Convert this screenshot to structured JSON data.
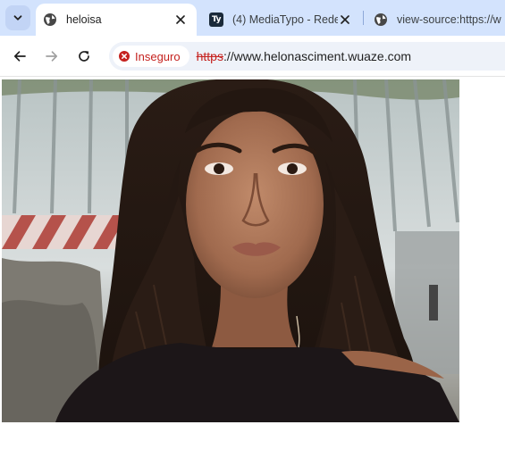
{
  "browser": {
    "tabs": [
      {
        "title": "heloisa",
        "active": true,
        "favicon": "globe-icon"
      },
      {
        "title": "(4) MediaTypo - Rede",
        "active": false,
        "favicon": "mediatypo-icon",
        "favicon_text": "Ty"
      },
      {
        "title": "view-source:https://w",
        "active": false,
        "favicon": "globe-icon"
      }
    ],
    "security_label": "Inseguro",
    "url_scheme": "https",
    "url_rest": "://www.helonasciment.wuaze.com"
  },
  "page": {
    "image_subject": "portrait photo"
  },
  "colors": {
    "tabbar_bg": "#d3e3fd",
    "insecure_red": "#c5221f"
  }
}
